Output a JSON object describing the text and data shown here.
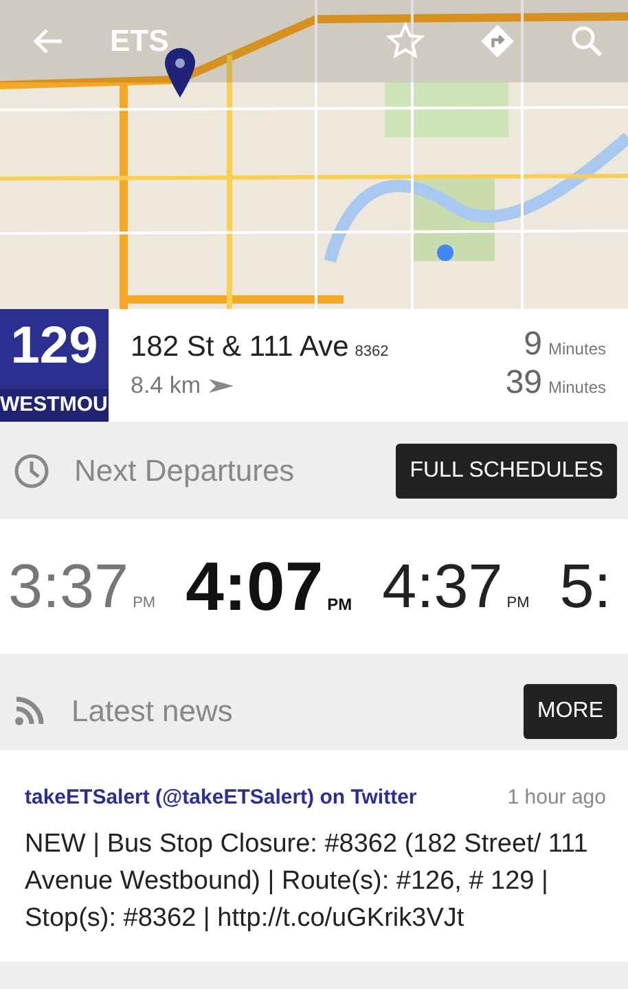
{
  "app_bar": {
    "title": "ETS"
  },
  "stop": {
    "route_number": "129",
    "route_name": "WESTMOU",
    "name": "182 St & 111 Ave",
    "code": "8362",
    "distance": "8.4 km",
    "arrivals": [
      {
        "value": "9",
        "unit": "Minutes"
      },
      {
        "value": "39",
        "unit": "Minutes"
      }
    ]
  },
  "departures": {
    "title": "Next Departures",
    "button": "FULL SCHEDULES",
    "times": [
      {
        "time": "3:37",
        "suffix": "PM",
        "kind": "past"
      },
      {
        "time": "4:07",
        "suffix": "PM",
        "kind": "next"
      },
      {
        "time": "4:37",
        "suffix": "PM",
        "kind": "upcoming"
      },
      {
        "time": "5:",
        "kind": "upcoming"
      }
    ]
  },
  "news": {
    "title": "Latest news",
    "button": "MORE",
    "items": [
      {
        "source": "takeETSalert (@takeETSalert) on Twitter",
        "time": "1 hour ago",
        "text": "NEW | Bus Stop Closure: #8362 (182 Street/ 111 Avenue Westbound) | Route(s): #126, # 129 | Stop(s): #8362 | http://t.co/uGKrik3VJt"
      }
    ]
  }
}
